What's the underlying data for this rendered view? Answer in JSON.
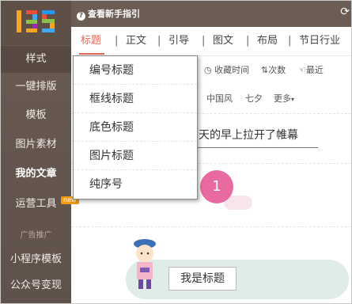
{
  "topbar": {
    "guide_label": "查看新手指引",
    "refresh_icon": "refresh-icon"
  },
  "sidebar": {
    "logo_text": "135",
    "items": [
      {
        "label": "样式"
      },
      {
        "label": "一键排版"
      },
      {
        "label": "模板"
      },
      {
        "label": "图片素材"
      },
      {
        "label": "我的文章"
      },
      {
        "label": "运营工具"
      },
      {
        "label": "广告推广"
      },
      {
        "label": "小程序模板"
      },
      {
        "label": "公众号变现"
      }
    ],
    "new_badge": "new"
  },
  "tabs": [
    "标题",
    "正文",
    "引导",
    "图文",
    "布局",
    "节日行业"
  ],
  "sort": {
    "collect_time": "收藏时间",
    "count": "次数",
    "recent": "最近"
  },
  "tags": [
    "中国风",
    "七夕",
    "更多"
  ],
  "dropdown": [
    "编号标题",
    "框线标题",
    "底色标题",
    "图片标题",
    "纯序号"
  ],
  "content": {
    "winter_text": "冬天的早上拉开了帷幕",
    "number": "1",
    "title_label": "我是标题"
  },
  "colors": {
    "sidebar": "#6a5a52",
    "accent": "#e36a5a",
    "badge": "#f29b11",
    "circle": "#e86aa0"
  }
}
